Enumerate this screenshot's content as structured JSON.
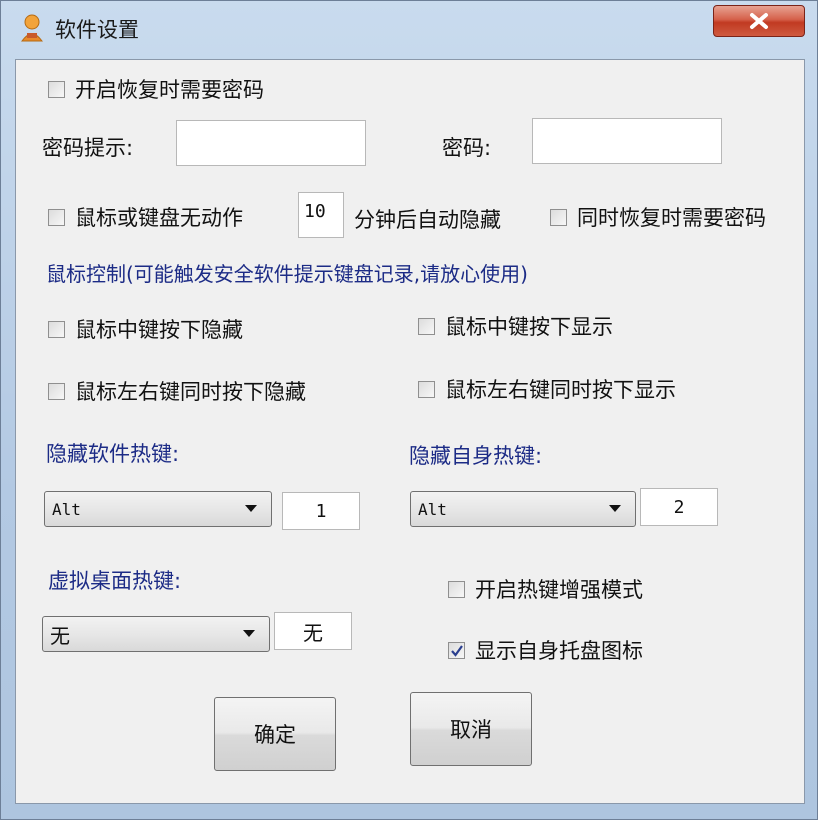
{
  "window": {
    "title": "软件设置",
    "close_label": "×"
  },
  "require_password_on_restore": {
    "label": "开启恢复时需要密码",
    "checked": false
  },
  "password_hint": {
    "label": "密码提示:",
    "value": ""
  },
  "password": {
    "label": "密码:",
    "value": ""
  },
  "idle_hide": {
    "label": "鼠标或键盘无动作",
    "minutes_value": "10",
    "suffix": "分钟后自动隐藏",
    "checked": false
  },
  "also_require_password": {
    "label": "同时恢复时需要密码",
    "checked": false
  },
  "mouse_control_heading": "鼠标控制(可能触发安全软件提示键盘记录,请放心使用)",
  "mouse_options": {
    "middle_hide": {
      "label": "鼠标中键按下隐藏",
      "checked": false
    },
    "middle_show": {
      "label": "鼠标中键按下显示",
      "checked": false
    },
    "lr_hide": {
      "label": "鼠标左右键同时按下隐藏",
      "checked": false
    },
    "lr_show": {
      "label": "鼠标左右键同时按下显示",
      "checked": false
    }
  },
  "hide_software_hotkey": {
    "label": "隐藏软件热键:",
    "modifier": "Alt",
    "key": "1"
  },
  "hide_self_hotkey": {
    "label": "隐藏自身热键:",
    "modifier": "Alt",
    "key": "2"
  },
  "virtual_desktop_hotkey": {
    "label": "虚拟桌面热键:",
    "modifier": "无",
    "key": "无"
  },
  "hotkey_enhanced_mode": {
    "label": "开启热键增强模式",
    "checked": false
  },
  "show_tray_icon": {
    "label": "显示自身托盘图标",
    "checked": true
  },
  "buttons": {
    "ok": "确定",
    "cancel": "取消"
  }
}
